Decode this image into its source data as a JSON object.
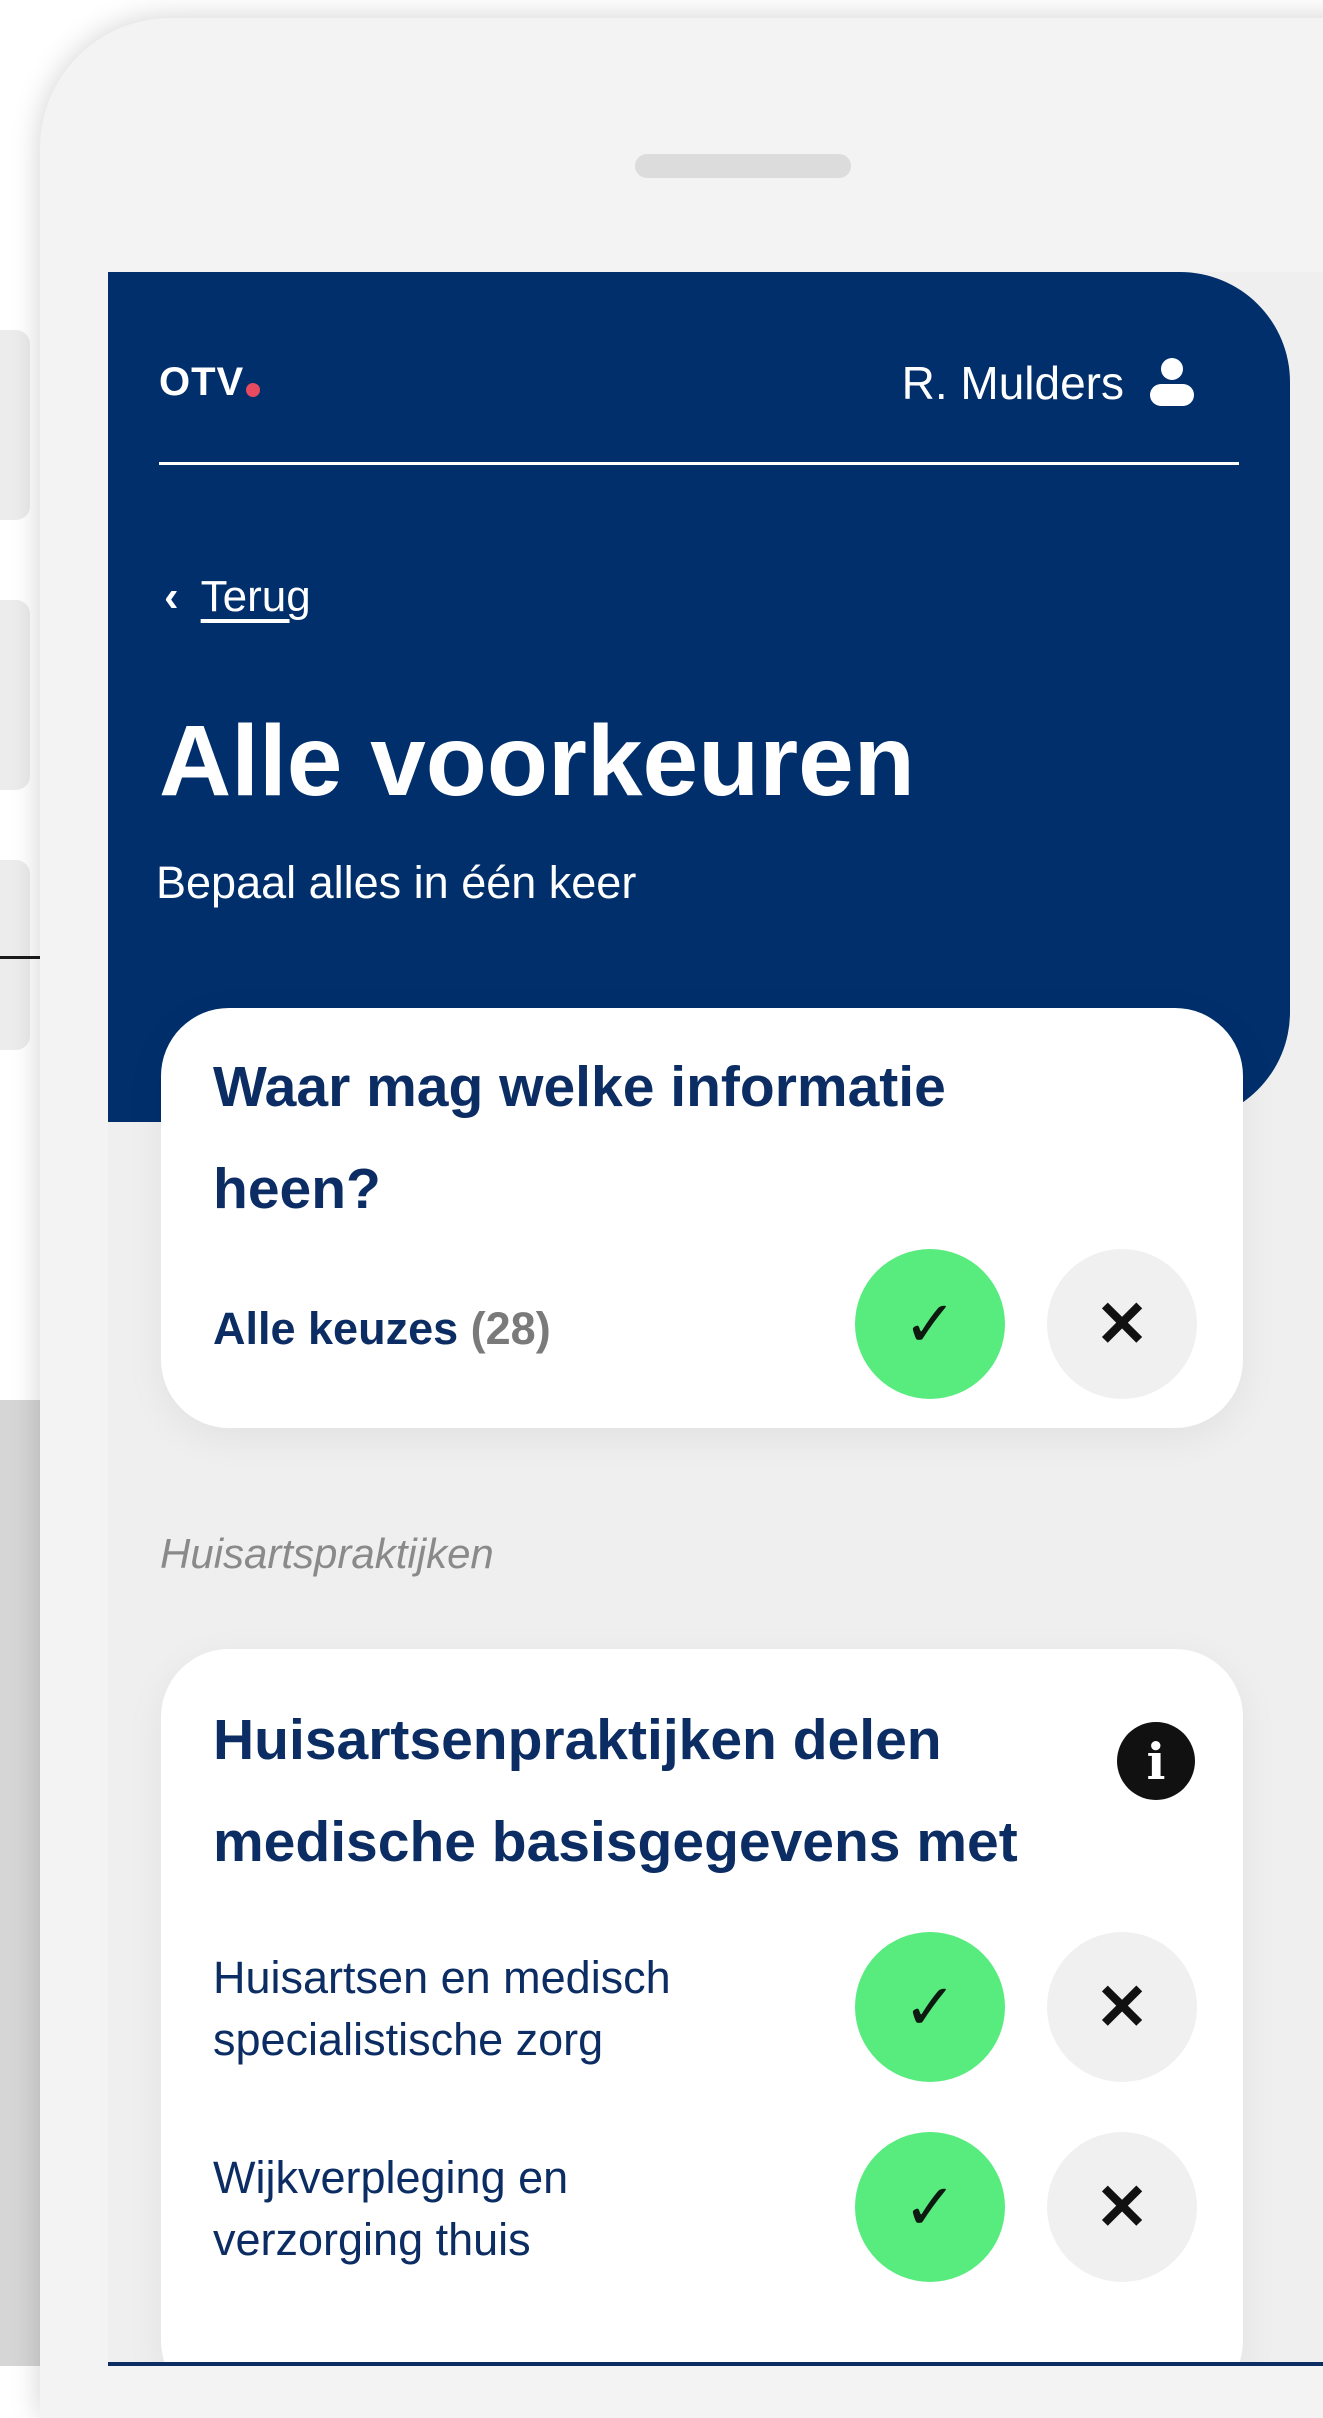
{
  "header": {
    "logo": "OTV",
    "user_name": "R. Mulders",
    "back_label": "Terug",
    "title": "Alle voorkeuren",
    "subtitle": "Bepaal alles in één keer"
  },
  "summary_card": {
    "title": "Waar mag welke informatie heen?",
    "row_label": "Alle keuzes",
    "row_count": "(28)",
    "yes_icon": "✓",
    "no_icon": "✕"
  },
  "section": {
    "label": "Huisartspraktijken"
  },
  "practice_card": {
    "title": "Huisartsenpraktijken delen medische basisgegevens met",
    "info_icon": "i",
    "rows": [
      {
        "label": "Huisartsen en medisch specialistische zorg",
        "yes_icon": "✓",
        "no_icon": "✕"
      },
      {
        "label": "Wijkverpleging en verzorging thuis",
        "yes_icon": "✓",
        "no_icon": "✕"
      }
    ]
  },
  "colors": {
    "header_bg": "#002f6c",
    "title_text": "#0b2d63",
    "accent_green": "#58ec7f",
    "logo_dot": "#e84a5f"
  }
}
